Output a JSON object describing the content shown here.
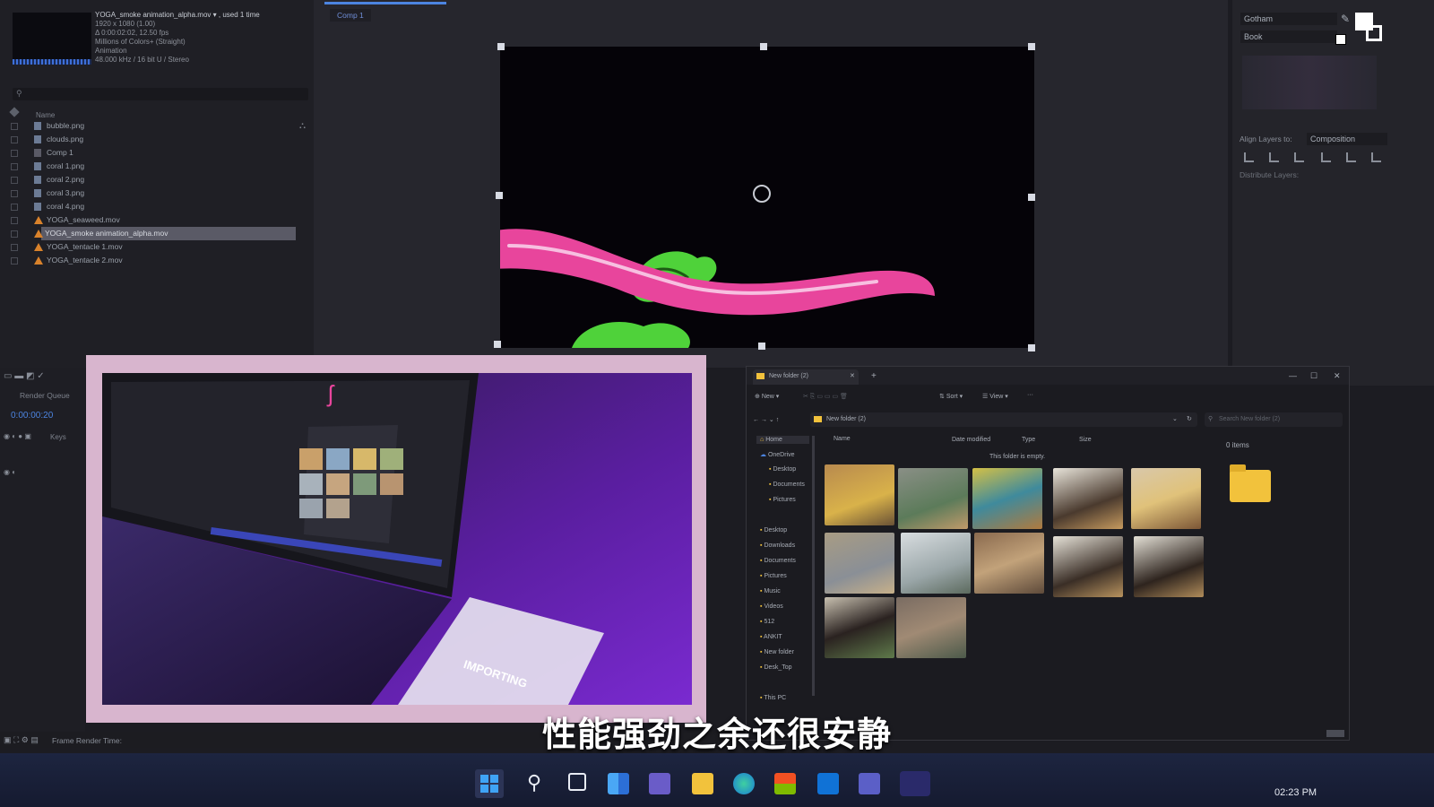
{
  "project": {
    "file_name": "YOGA_smoke animation_alpha.mov",
    "used_text": "▾ , used 1 time",
    "meta_lines": [
      "1920 x 1080 (1.00)",
      "Δ 0:00:02:02, 12.50 fps",
      "Millions of Colors+ (Straight)",
      "Animation",
      "48.000 kHz / 16 bit U / Stereo"
    ],
    "name_header": "Name",
    "items": [
      {
        "label": "bubble.png",
        "kind": "png"
      },
      {
        "label": "clouds.png",
        "kind": "png"
      },
      {
        "label": "Comp 1",
        "kind": "comp"
      },
      {
        "label": "coral 1.png",
        "kind": "png"
      },
      {
        "label": "coral 2.png",
        "kind": "png"
      },
      {
        "label": "coral 3.png",
        "kind": "png"
      },
      {
        "label": "coral 4.png",
        "kind": "png"
      },
      {
        "label": "YOGA_seaweed.mov",
        "kind": "mov"
      },
      {
        "label": "YOGA_smoke animation_alpha.mov",
        "kind": "mov",
        "selected": true
      },
      {
        "label": "YOGA_tentacle 1.mov",
        "kind": "mov"
      },
      {
        "label": "YOGA_tentacle 2.mov",
        "kind": "mov"
      }
    ]
  },
  "viewer": {
    "comp_tab": "Comp 1"
  },
  "character_panel": {
    "font": "Gotham",
    "style": "Book"
  },
  "align_panel": {
    "align_label": "Align Layers to:",
    "align_value": "Composition",
    "distribute_label": "Distribute Layers:"
  },
  "timeline": {
    "render_queue": "Render Queue",
    "timecode": "0:00:00:20",
    "keys_label": "Keys",
    "frame_render_time": "Frame Render Time:"
  },
  "explorer": {
    "tab_title": "New folder (2)",
    "new_label": "New",
    "sort_label": "Sort",
    "view_label": "View",
    "more_label": "···",
    "breadcrumb": "New folder (2)",
    "search_placeholder": "Search New folder (2)",
    "columns": [
      "Name",
      "Date modified",
      "Type",
      "Size"
    ],
    "empty_text": "This folder is empty.",
    "items_count": "0 items",
    "nav": [
      "Home",
      "OneDrive",
      "Desktop",
      "Documents",
      "Pictures",
      "Desktop",
      "Downloads",
      "Documents",
      "Pictures",
      "Music",
      "Videos",
      "512",
      "ANKIT",
      "New folder",
      "Desk_Top",
      "This PC"
    ]
  },
  "laptop_screen": {
    "phone_text": "IMPORTING"
  },
  "subtitle": "性能强劲之余还很安静",
  "taskbar": {
    "clock": "02:23 PM"
  },
  "colors": {
    "accent": "#4c84e0",
    "tentacle": "#e8459c",
    "seaweed": "#4fd23a",
    "folder": "#f2c23c",
    "frame": "#d8b5ce"
  }
}
